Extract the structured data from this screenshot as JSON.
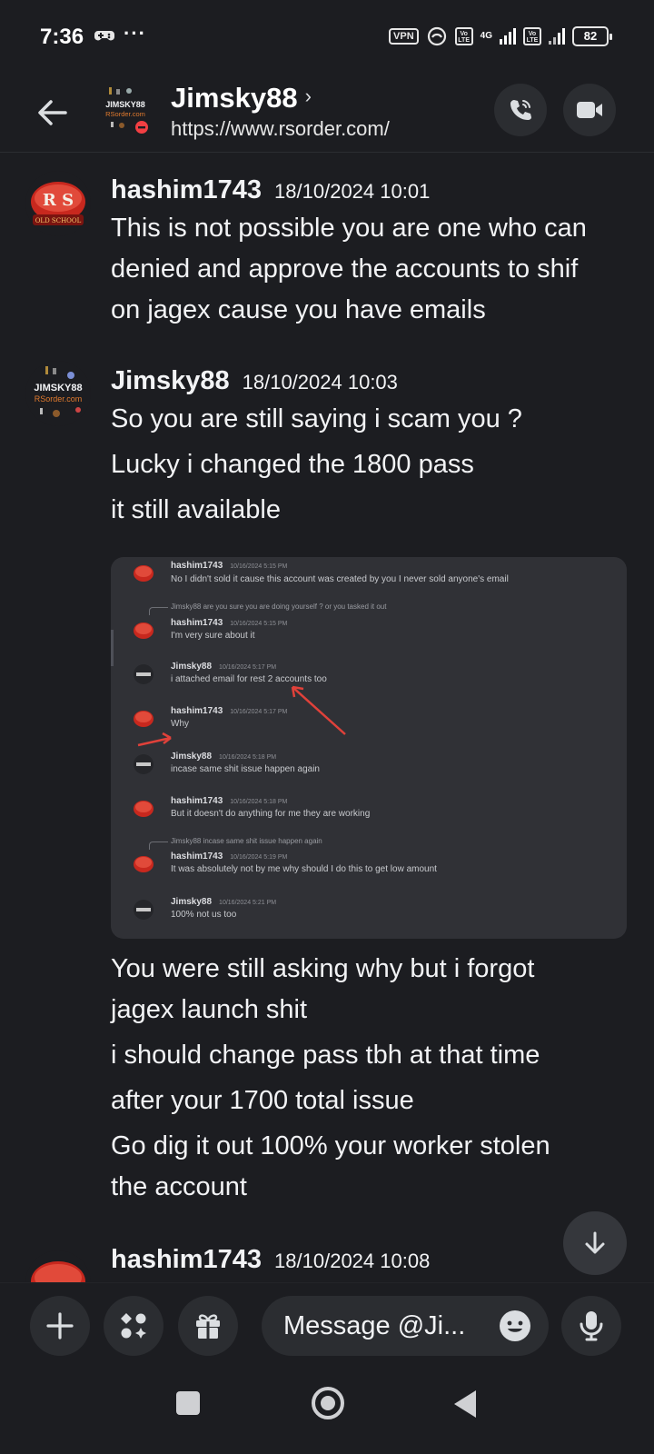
{
  "status_bar": {
    "time": "7:36",
    "dots": "···",
    "vpn": "VPN",
    "lte1": "Vo LTE",
    "net": "4G",
    "lte2": "Vo LTE",
    "battery": "82"
  },
  "header": {
    "title": "Jimsky88",
    "chevron": "›",
    "status": "https://www.rsorder.com/",
    "avatar_text_top": "JIMSKY88",
    "avatar_text_bottom": "RSorder.com"
  },
  "messages": [
    {
      "author": "hashim1743",
      "timestamp": "18/10/2024 10:01",
      "avatar_text": "R S",
      "avatar_subtext": "OLD SCHOOL",
      "lines": [
        "This is not possible you are one who can",
        "denied and approve the accounts to shif",
        "on jagex cause you have emails"
      ]
    },
    {
      "author": "Jimsky88",
      "timestamp": "18/10/2024 10:03",
      "avatar_text": "JIMSKY88",
      "avatar_subtext": "RSorder.com",
      "lines": [
        "So you are still saying i scam you ?",
        "Lucky i changed the 1800 pass",
        "it still available"
      ],
      "lines_after_image": [
        "You were still asking why but i forgot",
        "jagex launch shit",
        "i should change pass tbh at that time",
        "after your 1700 total issue",
        "Go dig it out 100% your worker stolen",
        "the account"
      ]
    },
    {
      "author": "hashim1743",
      "timestamp": "18/10/2024 10:08"
    }
  ],
  "embedded_screenshot": {
    "messages": [
      {
        "author": "hashim1743",
        "time": "10/16/2024 5:15 PM",
        "text": "No I didn't sold it cause this account was created by you I never sold anyone's email"
      },
      {
        "reply": "Jimsky88 are you sure you are doing yourself ? or you tasked it out"
      },
      {
        "author": "hashim1743",
        "time": "10/16/2024 5:15 PM",
        "text": "I'm very sure about it"
      },
      {
        "author": "Jimsky88",
        "time": "10/16/2024 5:17 PM",
        "text": "i attached email for rest 2 accounts too"
      },
      {
        "author": "hashim1743",
        "time": "10/16/2024 5:17 PM",
        "text": "Why"
      },
      {
        "author": "Jimsky88",
        "time": "10/16/2024 5:18 PM",
        "text": "incase same shit issue happen again"
      },
      {
        "author": "hashim1743",
        "time": "10/16/2024 5:18 PM",
        "text": "But it doesn't do anything for me they are working"
      },
      {
        "reply": "Jimsky88 incase same shit issue happen again"
      },
      {
        "author": "hashim1743",
        "time": "10/16/2024 5:19 PM",
        "text": "It was absolutely not by me why should I do this to get low amount"
      },
      {
        "author": "Jimsky88",
        "time": "10/16/2024 5:21 PM",
        "text": "100% not us too"
      }
    ]
  },
  "composer": {
    "placeholder": "Message @Ji..."
  },
  "icons": {
    "back": "arrow-left-icon",
    "call": "phone-icon",
    "video": "video-camera-icon",
    "scroll_down": "arrow-down-icon",
    "plus": "plus-icon",
    "apps": "apps-icon",
    "gift": "gift-icon",
    "emoji": "emoji-icon",
    "mic": "microphone-icon"
  },
  "colors": {
    "background": "#1c1d21",
    "surface": "#2b2d31",
    "text": "#f2f3f5",
    "rs_red": "#c8281e",
    "annotation_arrow": "#e0413a"
  }
}
